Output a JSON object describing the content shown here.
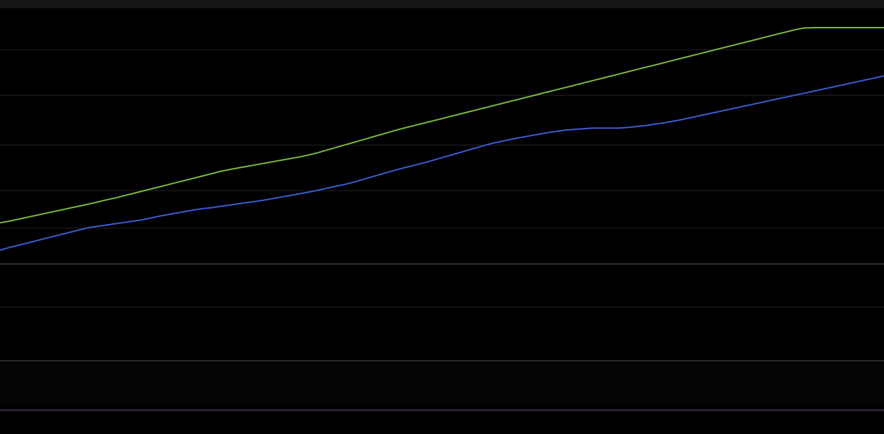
{
  "chart_data": {
    "type": "line",
    "title": "",
    "xlabel": "",
    "ylabel": "",
    "x": [
      0,
      10,
      20,
      30,
      40,
      50,
      60,
      70,
      80,
      90,
      100,
      110,
      120,
      130,
      140,
      150,
      160,
      170,
      180,
      190,
      200,
      210,
      220,
      230,
      240,
      250,
      260,
      270,
      280,
      290,
      300,
      310,
      320,
      330,
      340,
      350,
      360,
      370,
      380,
      390,
      400,
      410,
      420,
      430,
      440,
      450,
      460,
      470,
      480,
      490,
      500,
      510,
      520,
      530,
      540,
      550,
      560,
      570,
      580,
      590,
      600,
      610,
      620,
      630,
      640,
      650,
      660,
      670,
      680,
      690,
      700,
      710,
      720,
      730,
      740,
      750,
      760,
      770,
      780,
      790,
      800,
      810,
      820,
      830,
      840,
      850,
      860,
      870,
      880,
      890,
      900,
      910,
      920,
      930,
      940,
      950,
      960,
      970,
      980,
      990,
      1000
    ],
    "xlim": [
      0,
      1000
    ],
    "ylim": [
      0,
      100
    ],
    "grid": true,
    "series": [
      {
        "color": "#7dbb3a",
        "values": [
          38.6,
          39.1,
          39.7,
          40.3,
          40.9,
          41.5,
          42.1,
          42.7,
          43.3,
          43.9,
          44.5,
          45.1,
          45.8,
          46.4,
          47.1,
          47.8,
          48.5,
          49.2,
          49.9,
          50.6,
          51.3,
          52.0,
          52.7,
          53.4,
          54.1,
          54.8,
          55.4,
          55.9,
          56.4,
          56.9,
          57.4,
          57.9,
          58.4,
          58.9,
          59.4,
          60.0,
          60.7,
          61.5,
          62.3,
          63.1,
          63.9,
          64.7,
          65.5,
          66.3,
          67.1,
          67.9,
          68.6,
          69.3,
          70.0,
          70.7,
          71.4,
          72.1,
          72.8,
          73.5,
          74.2,
          74.9,
          75.6,
          76.3,
          77.0,
          77.7,
          78.4,
          79.1,
          79.8,
          80.5,
          81.2,
          81.9,
          82.6,
          83.3,
          84.0,
          84.7,
          85.4,
          86.1,
          86.8,
          87.5,
          88.2,
          88.9,
          89.6,
          90.3,
          91.0,
          91.7,
          92.4,
          93.1,
          93.8,
          94.5,
          95.2,
          95.9,
          96.6,
          97.3,
          98.0,
          98.7,
          99.4,
          99.9,
          100,
          100,
          100,
          100,
          100,
          100,
          100,
          100,
          100
        ]
      },
      {
        "color": "#3a5ed6",
        "values": [
          30.0,
          30.8,
          31.5,
          32.2,
          32.9,
          33.6,
          34.3,
          35.0,
          35.7,
          36.4,
          37.1,
          37.5,
          37.9,
          38.3,
          38.7,
          39.1,
          39.5,
          40.1,
          40.7,
          41.2,
          41.7,
          42.2,
          42.7,
          43.1,
          43.4,
          43.8,
          44.2,
          44.6,
          45.0,
          45.4,
          45.8,
          46.3,
          46.8,
          47.3,
          47.8,
          48.3,
          48.9,
          49.5,
          50.1,
          50.7,
          51.4,
          52.2,
          53.0,
          53.8,
          54.6,
          55.4,
          56.1,
          56.8,
          57.5,
          58.3,
          59.1,
          59.9,
          60.7,
          61.5,
          62.3,
          63.1,
          63.8,
          64.4,
          65.0,
          65.5,
          66.0,
          66.5,
          67.0,
          67.4,
          67.8,
          68.0,
          68.2,
          68.4,
          68.4,
          68.4,
          68.4,
          68.6,
          68.9,
          69.2,
          69.6,
          70.0,
          70.5,
          71.0,
          71.6,
          72.2,
          72.8,
          73.4,
          74.0,
          74.6,
          75.2,
          75.8,
          76.4,
          77.0,
          77.6,
          78.2,
          78.8,
          79.4,
          80.0,
          80.6,
          81.2,
          81.8,
          82.4,
          83.0,
          83.6,
          84.2,
          84.8
        ]
      }
    ]
  }
}
